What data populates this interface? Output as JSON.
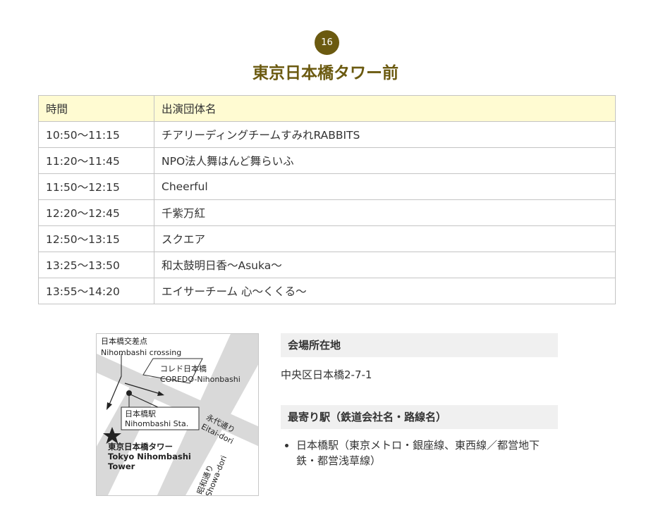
{
  "venue": {
    "number": "16",
    "name": "東京日本橋タワー前"
  },
  "schedule": {
    "headers": [
      "時間",
      "出演団体名"
    ],
    "rows": [
      {
        "time": "10:50～11:15",
        "group": "チアリーディングチームすみれRABBITS"
      },
      {
        "time": "11:20～11:45",
        "group": "NPO法人舞はんど舞らいふ"
      },
      {
        "time": "11:50～12:15",
        "group": "Cheerful"
      },
      {
        "time": "12:20～12:45",
        "group": "千紫万紅"
      },
      {
        "time": "12:50～13:15",
        "group": "スクエア"
      },
      {
        "time": "13:25～13:50",
        "group": "和太鼓明日香～Asuka～"
      },
      {
        "time": "13:55～14:20",
        "group": "エイサーチーム 心～くくる～"
      }
    ]
  },
  "map": {
    "crossing_jp": "日本橋交差点",
    "crossing_en": "Nihombashi crossing",
    "coredo_jp": "コレド日本橋",
    "coredo_en": "COREDO-Nihonbashi",
    "station_jp": "日本橋駅",
    "station_en": "Nihombashi Sta.",
    "tower_jp": "東京日本橋タワー",
    "tower_en_1": "Tokyo Nihombashi",
    "tower_en_2": "Tower",
    "eitai_jp": "永代通り",
    "eitai_en": "Eitai-dori",
    "showa_jp": "昭和通り",
    "showa_en": "Showa-dori"
  },
  "location": {
    "heading": "会場所在地",
    "address": "中央区日本橋2-7-1"
  },
  "nearest": {
    "heading": "最寄り駅（鉄道会社名・路線名）",
    "items": [
      "日本橋駅（東京メトロ・銀座線、東西線／都営地下鉄・都営浅草線）"
    ]
  },
  "colors": {
    "accent": "#6b5a10",
    "table_header_bg": "#fffbd2",
    "info_header_bg": "#f0f0f0",
    "road_gray": "#d9d9d9"
  }
}
